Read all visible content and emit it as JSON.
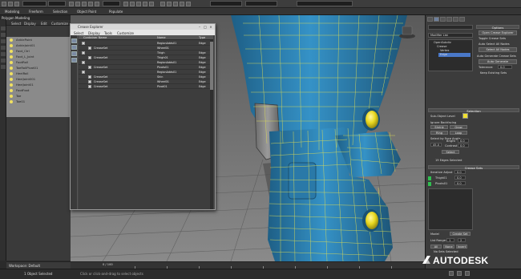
{
  "ribbon": {
    "tabs": [
      "Modeling",
      "Freeform",
      "Selection",
      "Object Paint",
      "Populate"
    ],
    "sub_tab": "Polygon Modeling"
  },
  "scene_explorer": {
    "menu": [
      "Select",
      "Display",
      "Edit",
      "Customize"
    ],
    "items": [
      "AnklePoint",
      "AnkleJoint01",
      "Foot_Ctrl",
      "Foot_L_Joint",
      "FootRoll",
      "ToeRollPivot01",
      "HeelRoll",
      "HeelJoint001",
      "HeelJoint01",
      "FootFoot",
      "Toe",
      "Toe01"
    ],
    "workspace_label": "Workspace: Default"
  },
  "dialog": {
    "title": "Crease Explorer",
    "menu": [
      "Select",
      "Display",
      "Tools",
      "Customize"
    ],
    "columns": [
      "Container Name",
      "Name",
      "Type"
    ],
    "rows": [
      {
        "name": "",
        "type": "Edge",
        "set": "RegionAdds01",
        "level": 0
      },
      {
        "name": "CreaseSet",
        "type": "",
        "set": "Wheel01",
        "level": 1
      },
      {
        "name": "",
        "type": "Edge",
        "set": "Thigh",
        "level": 0
      },
      {
        "name": "CreaseSet",
        "type": "Edge",
        "set": "Thigh01",
        "level": 1
      },
      {
        "name": "",
        "type": "Edge",
        "set": "RegionAdds01",
        "level": 0
      },
      {
        "name": "CreaseSet",
        "type": "Edge",
        "set": "Pivots01",
        "level": 1
      },
      {
        "name": "",
        "type": "Edge",
        "set": "RegionAdds01",
        "level": 0
      },
      {
        "name": "CreaseSet",
        "type": "Edge",
        "set": "Shin",
        "level": 1
      },
      {
        "name": "CreaseSet",
        "type": "Edge",
        "set": "Wheel01",
        "level": 1
      },
      {
        "name": "CreaseSet",
        "type": "Edge",
        "set": "Pivot01",
        "level": 1
      }
    ]
  },
  "command_panel": {
    "modifier_list": "Modifier List",
    "stack": [
      "OpenSubdiv",
      "Crease",
      "Vertex",
      "Edge"
    ],
    "stack_selected": "Edge",
    "options": {
      "title": "Options",
      "open_explorer": "Open Crease Explorer",
      "toggle": "Toggle Crease Sets",
      "auto_select": "Auto Select All Nodes",
      "select_all": "Select All Nodes",
      "auto_generate": "Auto Generate Crease Sets",
      "auto_gen_btn": "Auto Generate",
      "tolerance_label": "Tolerance:",
      "tolerance_value": "0.0",
      "keep_existing": "Keep Existing Sets"
    },
    "selection": {
      "title": "Selection",
      "sub_object": "Sub-Object Level",
      "ignore_backfacing": "Ignore Backfacing",
      "shrink": "Shrink",
      "grow": "Grow",
      "ring": "Ring",
      "loop": "Loop",
      "by_angle": "Select by Face Angle",
      "angle_value": "45.0",
      "bright_label": "Bright",
      "bright_value": "0.0",
      "contrast_label": "Contrast",
      "contrast_value": "0.0",
      "select_btn": "Select",
      "status": "19 Edges Selected"
    },
    "crease_sets": {
      "title": "Crease Sets",
      "iterative": "Iterative Adjust",
      "iterative_value": "0.0",
      "sets": [
        {
          "name": "Thigh01",
          "value": "0.0"
        },
        {
          "name": "Pivots01",
          "value": "0.0"
        }
      ],
      "create_set": "Create Set",
      "list_range": "List Range:",
      "list_from": "1",
      "list_to": "2",
      "all": "All",
      "none": "None",
      "invert": "Invert",
      "status": "No Sets Selected"
    },
    "colors": {
      "selected_stack": "#4a78c8",
      "swatch_yellow": "#f0e030",
      "swatch_green": "#30c050"
    }
  },
  "timeline": {
    "frame": "0 / 100"
  },
  "status": {
    "selection": "1 Object Selected",
    "hint": "Click or click-and-drag to select objects"
  },
  "brand": {
    "logo_text": "AUTODESK"
  },
  "viewport": {
    "colors": {
      "mesh": "#2f86b8",
      "wire": "#e2e25a",
      "joint": "#f0e020"
    }
  }
}
